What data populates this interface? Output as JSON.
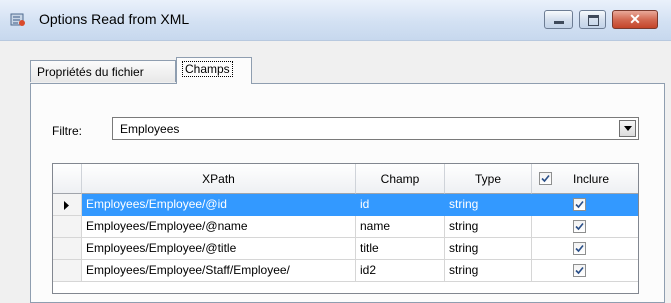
{
  "window": {
    "title": "Options Read from XML",
    "close_glyph": "✕"
  },
  "tabs": [
    {
      "label": "Propriétés du fichier",
      "active": false
    },
    {
      "label": "Champs",
      "active": true
    }
  ],
  "filter": {
    "label": "Filtre:",
    "value": "Employees"
  },
  "grid": {
    "columns": [
      "XPath",
      "Champ",
      "Type",
      "Inclure"
    ],
    "header_include_checked": true,
    "rows": [
      {
        "xpath": "Employees/Employee/@id",
        "champ": "id",
        "type": "string",
        "include": true,
        "selected": true
      },
      {
        "xpath": "Employees/Employee/@name",
        "champ": "name",
        "type": "string",
        "include": true,
        "selected": false
      },
      {
        "xpath": "Employees/Employee/@title",
        "champ": "title",
        "type": "string",
        "include": true,
        "selected": false
      },
      {
        "xpath": "Employees/Employee/Staff/Employee/",
        "champ": "id2",
        "type": "string",
        "include": true,
        "selected": false
      }
    ]
  },
  "colors": {
    "selection": "#3399ff",
    "close_button": "#c3452a"
  },
  "icons": {
    "app": "app-icon",
    "row_indicator": "row-pointer-icon",
    "dropdown": "chevron-down-icon"
  }
}
